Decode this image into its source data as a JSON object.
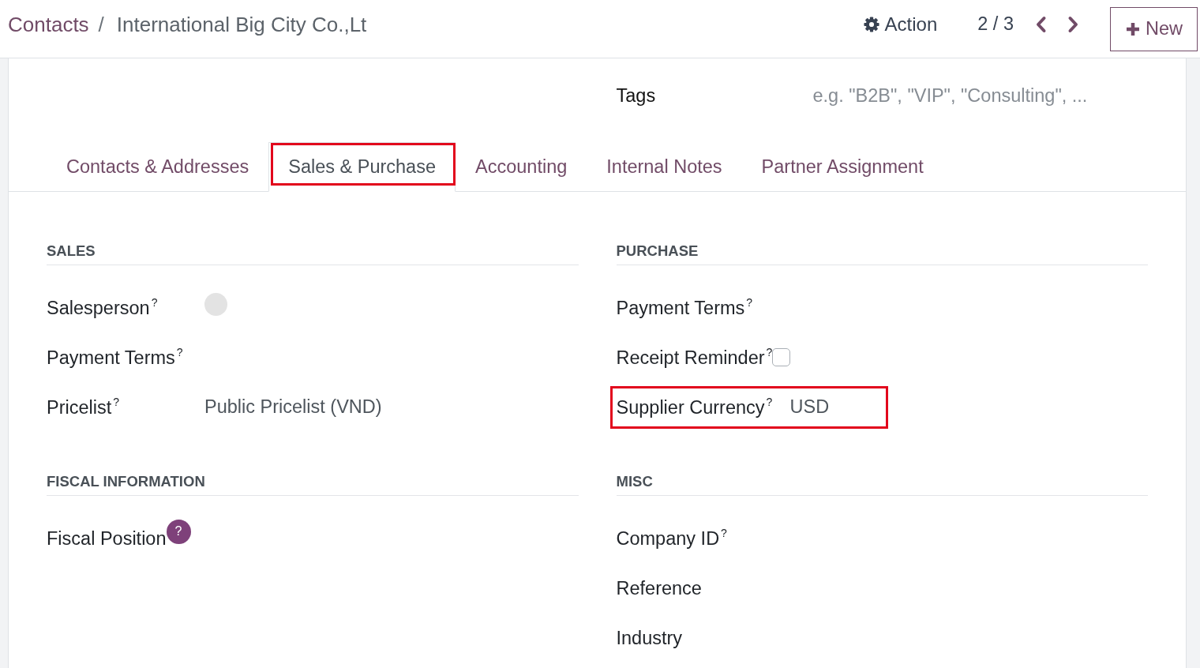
{
  "breadcrumb": {
    "parent": "Contacts",
    "separator": "/",
    "current": "International Big City Co.,Lt"
  },
  "toolbar": {
    "action": "Action",
    "pager": "2 / 3",
    "new_label": "New"
  },
  "tags": {
    "label": "Tags",
    "placeholder": "e.g. \"B2B\", \"VIP\", \"Consulting\", ..."
  },
  "tabs": [
    {
      "label": "Contacts & Addresses",
      "selected": false,
      "highlighted": false
    },
    {
      "label": "Sales & Purchase",
      "selected": true,
      "highlighted": true
    },
    {
      "label": "Accounting",
      "selected": false,
      "highlighted": false
    },
    {
      "label": "Internal Notes",
      "selected": false,
      "highlighted": false
    },
    {
      "label": "Partner Assignment",
      "selected": false,
      "highlighted": false
    }
  ],
  "groups": [
    {
      "title": "SALES",
      "fields": [
        {
          "label": "Salesperson",
          "help": "?",
          "help_active": false,
          "kind": "avatar",
          "highlighted": false
        },
        {
          "label": "Payment Terms",
          "help": "?",
          "help_active": false,
          "kind": "empty",
          "highlighted": false
        },
        {
          "label": "Pricelist",
          "help": "?",
          "help_active": false,
          "kind": "text",
          "value": "Public Pricelist (VND)",
          "highlighted": false
        }
      ]
    },
    {
      "title": "PURCHASE",
      "fields": [
        {
          "label": "Payment Terms",
          "help": "?",
          "help_active": false,
          "kind": "empty",
          "highlighted": false
        },
        {
          "label": "Receipt Reminder",
          "help": "?",
          "help_active": false,
          "kind": "checkbox",
          "checked": false,
          "highlighted": false
        },
        {
          "label": "Supplier Currency",
          "help": "?",
          "help_active": false,
          "kind": "text",
          "value": "USD",
          "highlighted": true
        }
      ]
    },
    {
      "title": "FISCAL INFORMATION",
      "fields": [
        {
          "label": "Fiscal Position",
          "help": "?",
          "help_active": true,
          "kind": "empty",
          "highlighted": false
        }
      ]
    },
    {
      "title": "MISC",
      "fields": [
        {
          "label": "Company ID",
          "help": "?",
          "help_active": false,
          "kind": "empty",
          "highlighted": false
        },
        {
          "label": "Reference",
          "kind": "empty",
          "highlighted": false
        },
        {
          "label": "Industry",
          "kind": "empty",
          "highlighted": false
        }
      ]
    }
  ]
}
